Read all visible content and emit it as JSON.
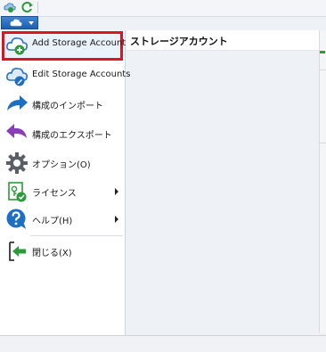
{
  "background": {
    "column_header": "ストレージアカウント"
  },
  "app_menu": {
    "items": [
      {
        "label": "Add Storage Account",
        "icon": "cloud-add-icon",
        "has_submenu": false,
        "highlighted": true
      },
      {
        "label": "Edit Storage Accounts",
        "icon": "cloud-edit-icon",
        "has_submenu": false,
        "highlighted": false
      },
      {
        "label": "構成のインポート",
        "icon": "import-arrow-icon",
        "has_submenu": false,
        "highlighted": false
      },
      {
        "label": "構成のエクスポート",
        "icon": "export-arrow-icon",
        "has_submenu": false,
        "highlighted": false
      },
      {
        "label": "オプション(O)",
        "icon": "gear-icon",
        "has_submenu": false,
        "highlighted": false
      },
      {
        "label": "ライセンス",
        "icon": "license-icon",
        "has_submenu": true,
        "highlighted": false
      },
      {
        "label": "ヘルプ(H)",
        "icon": "help-icon",
        "has_submenu": true,
        "highlighted": false
      },
      {
        "label": "閉じる(X)",
        "icon": "exit-icon",
        "has_submenu": false,
        "highlighted": false
      }
    ]
  },
  "colors": {
    "highlight_border": "#e0141e",
    "accent_blue": "#1e6fc4",
    "accent_green": "#2c9a3a",
    "accent_purple": "#8a3fb8"
  }
}
